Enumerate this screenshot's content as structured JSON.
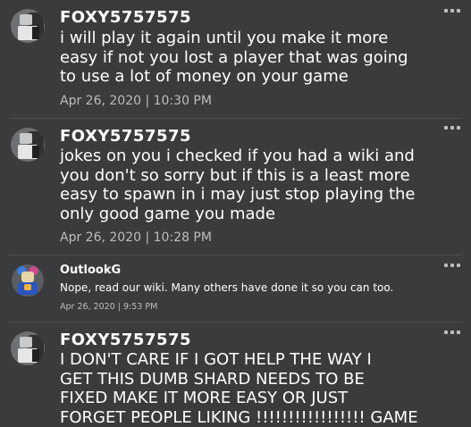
{
  "comments": [
    {
      "username": "FOXY5757575",
      "lines": [
        "i will play it again until you make it more",
        "easy if not you lost a player that was going",
        "to use a lot of money on your game"
      ],
      "timestamp": "Apr 26, 2020 | 10:30 PM",
      "avatar_icon": "avatar-icon"
    },
    {
      "username": "FOXY5757575",
      "lines": [
        "jokes on you i checked if you had a wiki and",
        "you don't so sorry but if this is a least more",
        "easy to spawn in i may just stop playing the",
        "only good game you made"
      ],
      "timestamp": "Apr 26, 2020 | 10:28 PM",
      "avatar_icon": "avatar-icon"
    },
    {
      "username": "OutlookG",
      "lines": [
        "Nope, read our wiki. Many others have done it so you can too."
      ],
      "timestamp": "Apr 26, 2020 | 9:53 PM",
      "avatar_icon": "avatar-icon"
    },
    {
      "username": "FOXY5757575",
      "lines": [
        "I DON'T CARE IF I GOT HELP THE WAY I",
        "GET THIS DUMB SHARD NEEDS TO BE",
        "FIXED MAKE IT MORE EASY OR JUST",
        "FORGET PEOPLE LIKING !!!!!!!!!!!!!!!!! GAME"
      ],
      "timestamp": "",
      "avatar_icon": "avatar-icon"
    }
  ],
  "menu_icon": "more-options-icon",
  "colors": {
    "background": "#393b3d",
    "divider": "#4d5052",
    "text": "#ffffff",
    "meta": "#bdbebe"
  }
}
